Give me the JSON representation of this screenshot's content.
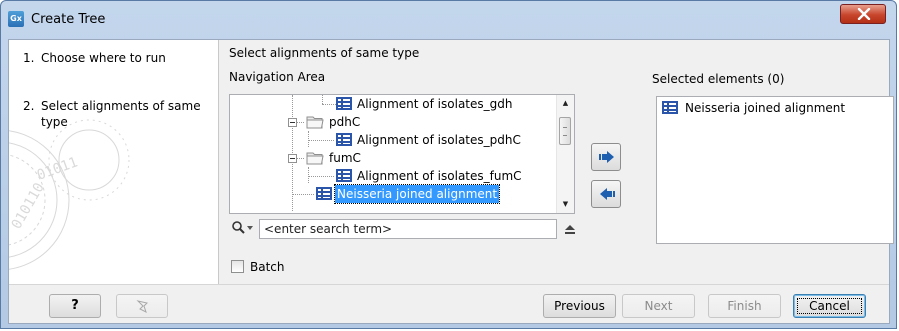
{
  "window": {
    "title": "Create Tree",
    "app_icon_text": "Gx"
  },
  "steps": [
    {
      "number": "1.",
      "label": "Choose where to run"
    },
    {
      "number": "2.",
      "label": "Select alignments of same type"
    }
  ],
  "panel": {
    "title": "Select alignments of same type",
    "navigation_label": "Navigation Area",
    "selected_label": "Selected elements (0)"
  },
  "tree": {
    "items": [
      {
        "label": "Alignment of isolates_gdh",
        "type": "alignment"
      },
      {
        "label": "pdhC",
        "type": "folder"
      },
      {
        "label": "Alignment of isolates_pdhC",
        "type": "alignment"
      },
      {
        "label": "fumC",
        "type": "folder"
      },
      {
        "label": "Alignment of isolates_fumC",
        "type": "alignment"
      },
      {
        "label": "Neisseria joined alignment",
        "type": "alignment",
        "selected": true
      }
    ]
  },
  "selected_elements": [
    {
      "label": "Neisseria joined alignment",
      "icon": "alignment-icon"
    }
  ],
  "search": {
    "placeholder": "<enter search term>",
    "value": ""
  },
  "batch": {
    "label": "Batch",
    "checked": false
  },
  "footer": {
    "help_label": "?",
    "previous_label": "Previous",
    "next_label": "Next",
    "finish_label": "Finish",
    "cancel_label": "Cancel"
  },
  "colors": {
    "selection": "#3399ff",
    "alignment_icon": "#2b55a8"
  }
}
